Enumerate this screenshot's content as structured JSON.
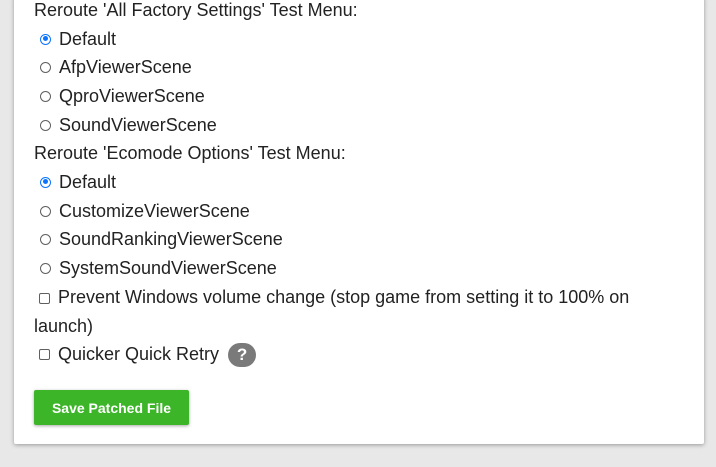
{
  "factory_menu": {
    "label": "Reroute 'All Factory Settings' Test Menu:",
    "options": [
      "Default",
      "AfpViewerScene",
      "QproViewerScene",
      "SoundViewerScene"
    ],
    "selected": "Default"
  },
  "ecomode_menu": {
    "label": "Reroute 'Ecomode Options' Test Menu:",
    "options": [
      "Default",
      "CustomizeViewerScene",
      "SoundRankingViewerScene",
      "SystemSoundViewerScene"
    ],
    "selected": "Default"
  },
  "prevent_volume": {
    "label": "Prevent Windows volume change (stop game from setting it to 100% on launch)",
    "checked": false
  },
  "quicker_retry": {
    "label": "Quicker Quick Retry",
    "checked": false,
    "help_glyph": "?"
  },
  "save_button": {
    "label": "Save Patched File",
    "color": "#3cb528"
  },
  "accent_color": "#0b73ff"
}
